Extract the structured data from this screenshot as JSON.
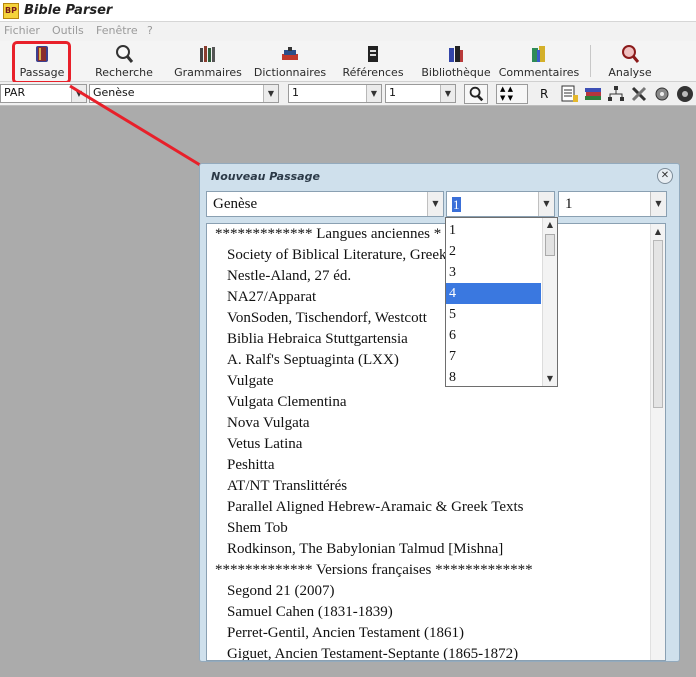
{
  "window": {
    "title": "Bible Parser",
    "icon": "bible-parser-app-icon",
    "icon_text": "BP"
  },
  "menu": [
    "Fichier",
    "Outils",
    "Fenêtre",
    "?"
  ],
  "toolbar": {
    "items": [
      {
        "label": "Passage",
        "icon": "book-icon"
      },
      {
        "label": "Recherche",
        "icon": "magnifier-icon"
      },
      {
        "label": "Grammaires",
        "icon": "books-icon"
      },
      {
        "label": "Dictionnaires",
        "icon": "dictionary-icon"
      },
      {
        "label": "Références",
        "icon": "reference-icon"
      },
      {
        "label": "Bibliothèque",
        "icon": "library-icon"
      },
      {
        "label": "Commentaires",
        "icon": "comments-icon"
      },
      {
        "label": "Analyse",
        "icon": "analysis-icon"
      }
    ],
    "highlight_color": "#e8202a"
  },
  "nav": {
    "version": "PAR",
    "book": "Genèse",
    "chapter": "1",
    "verse": "1",
    "r_button": "R"
  },
  "dialog": {
    "title": "Nouveau Passage",
    "book": "Genèse",
    "chapter": "1",
    "verse": "1",
    "versions": [
      {
        "text": "************* Langues anciennes *",
        "header": true
      },
      {
        "text": "Society of Biblical Literature, Greek New Testament",
        "header": false
      },
      {
        "text": "Nestle-Aland, 27 éd.",
        "header": false
      },
      {
        "text": "NA27/Apparat",
        "header": false
      },
      {
        "text": "VonSoden, Tischendorf, Westcott",
        "header": false
      },
      {
        "text": "Biblia Hebraica Stuttgartensia",
        "header": false
      },
      {
        "text": "A. Ralf's Septuaginta (LXX)",
        "header": false
      },
      {
        "text": "Vulgate",
        "header": false
      },
      {
        "text": "Vulgata Clementina",
        "header": false
      },
      {
        "text": "Nova Vulgata",
        "header": false
      },
      {
        "text": "Vetus Latina",
        "header": false
      },
      {
        "text": "Peshitta",
        "header": false
      },
      {
        "text": "AT/NT Translittérés",
        "header": false
      },
      {
        "text": "Parallel Aligned Hebrew-Aramaic & Greek Texts",
        "header": false
      },
      {
        "text": "Shem Tob",
        "header": false
      },
      {
        "text": "Rodkinson, The Babylonian Talmud [Mishna]",
        "header": false
      },
      {
        "text": "************* Versions françaises *************",
        "header": true
      },
      {
        "text": "Segond 21 (2007)",
        "header": false
      },
      {
        "text": "Samuel Cahen (1831-1839)",
        "header": false
      },
      {
        "text": "Perret-Gentil, Ancien Testament (1861)",
        "header": false
      },
      {
        "text": "Giguet, Ancien Testament-Septante (1865-1872)",
        "header": false
      }
    ],
    "chapter_options": [
      "1",
      "2",
      "3",
      "4",
      "5",
      "6",
      "7",
      "8"
    ],
    "selected_option": "4",
    "selection_color": "#3a78e0"
  }
}
